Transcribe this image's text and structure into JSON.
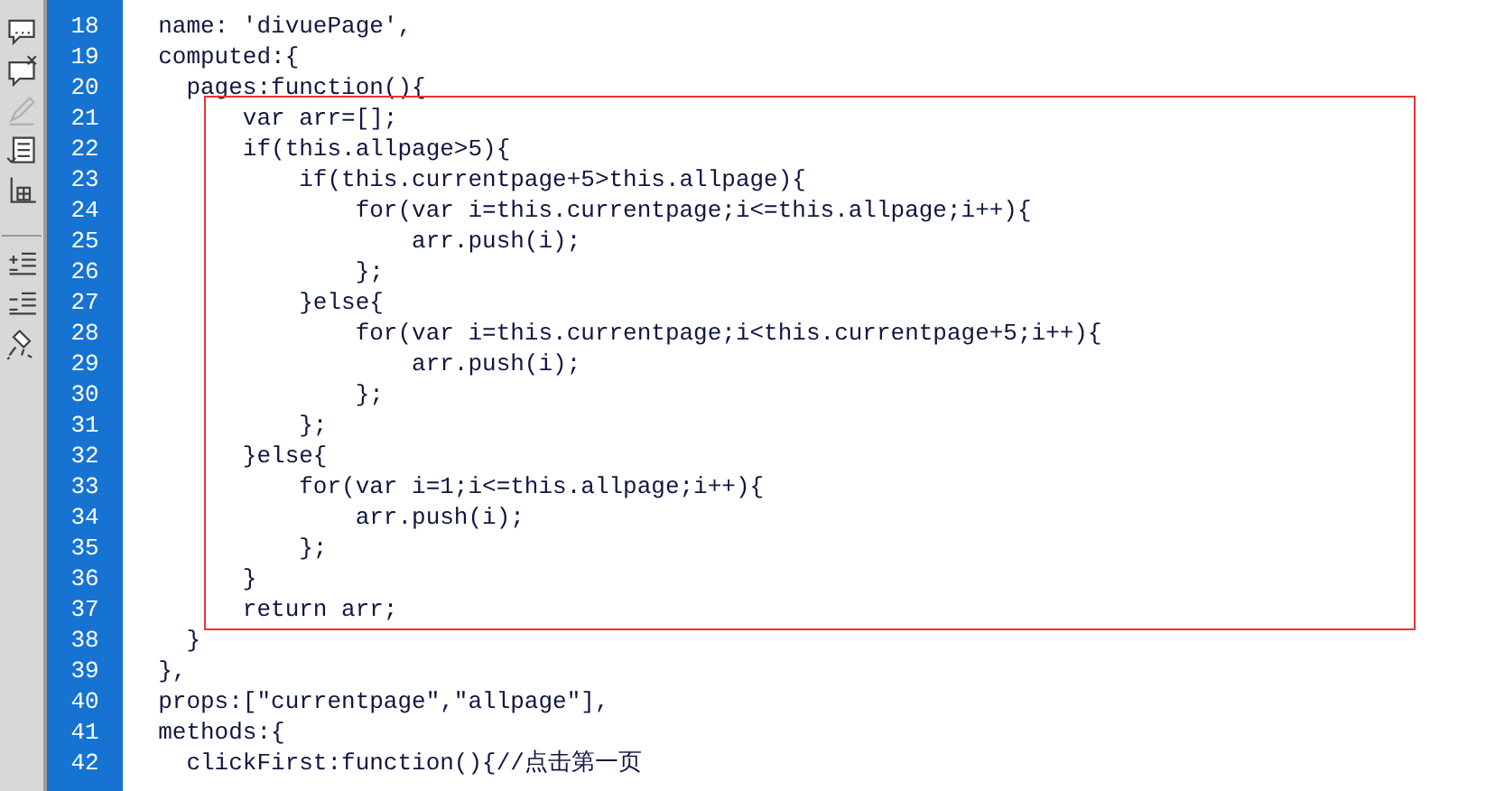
{
  "toolbar": [
    {
      "kind": "comment",
      "disabled": false
    },
    {
      "kind": "uncomment",
      "disabled": false
    },
    {
      "kind": "edit",
      "disabled": true
    },
    {
      "kind": "wrap",
      "disabled": false
    },
    {
      "kind": "grid",
      "disabled": false
    },
    {
      "kind": "indent",
      "disabled": false
    },
    {
      "kind": "outdent",
      "disabled": false
    },
    {
      "kind": "format",
      "disabled": false
    }
  ],
  "code": {
    "blocks": [
      {
        "kind": "plain",
        "lines": [
          {
            "number": "18",
            "text": "  name: 'divuePage',"
          },
          {
            "number": "19",
            "text": "  computed:{"
          },
          {
            "number": "20",
            "text": "    pages:function(){"
          }
        ]
      },
      {
        "kind": "outlined",
        "lines": [
          {
            "number": "21",
            "text": "        var arr=[];"
          },
          {
            "number": "22",
            "text": "        if(this.allpage>5){"
          },
          {
            "number": "23",
            "text": "            if(this.currentpage+5>this.allpage){"
          },
          {
            "number": "24",
            "text": "                for(var i=this.currentpage;i<=this.allpage;i++){"
          },
          {
            "number": "25",
            "text": "                    arr.push(i);"
          },
          {
            "number": "26",
            "text": "                };"
          },
          {
            "number": "27",
            "text": "            }else{"
          },
          {
            "number": "28",
            "text": "                for(var i=this.currentpage;i<this.currentpage+5;i++){"
          },
          {
            "number": "29",
            "text": "                    arr.push(i);"
          },
          {
            "number": "30",
            "text": "                };"
          },
          {
            "number": "31",
            "text": "            };"
          },
          {
            "number": "32",
            "text": "        }else{"
          },
          {
            "number": "33",
            "text": "            for(var i=1;i<=this.allpage;i++){"
          },
          {
            "number": "34",
            "text": "                arr.push(i);"
          },
          {
            "number": "35",
            "text": "            };"
          },
          {
            "number": "36",
            "text": "        }"
          },
          {
            "number": "37",
            "text": "        return arr;"
          }
        ]
      },
      {
        "kind": "plain",
        "lines": [
          {
            "number": "38",
            "text": "    }"
          },
          {
            "number": "39",
            "text": "  },"
          },
          {
            "number": "40",
            "text": "  props:[\"currentpage\",\"allpage\"],"
          },
          {
            "number": "41",
            "text": "  methods:{"
          },
          {
            "number": "42",
            "text": "    clickFirst:function(){//点击第一页"
          }
        ]
      }
    ]
  }
}
